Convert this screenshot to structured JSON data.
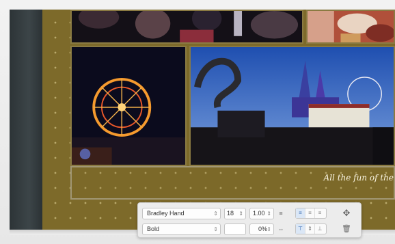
{
  "caption": {
    "text": "All the fun of the"
  },
  "format_bar": {
    "font_family": "Bradley Hand",
    "font_style": "Bold",
    "font_size": "18",
    "line_spacing": "1.00",
    "character_spacing": "0%",
    "text_color": "#ffffff",
    "icons": {
      "align": [
        "align-left-icon",
        "align-center-icon",
        "align-right-icon"
      ],
      "valign": [
        "align-top-icon",
        "align-middle-icon",
        "align-bottom-icon"
      ],
      "move": "move-icon",
      "delete": "trash-icon"
    }
  },
  "colors": {
    "page_background": "#7d6a2a",
    "caption_text": "#fbf6e4"
  }
}
